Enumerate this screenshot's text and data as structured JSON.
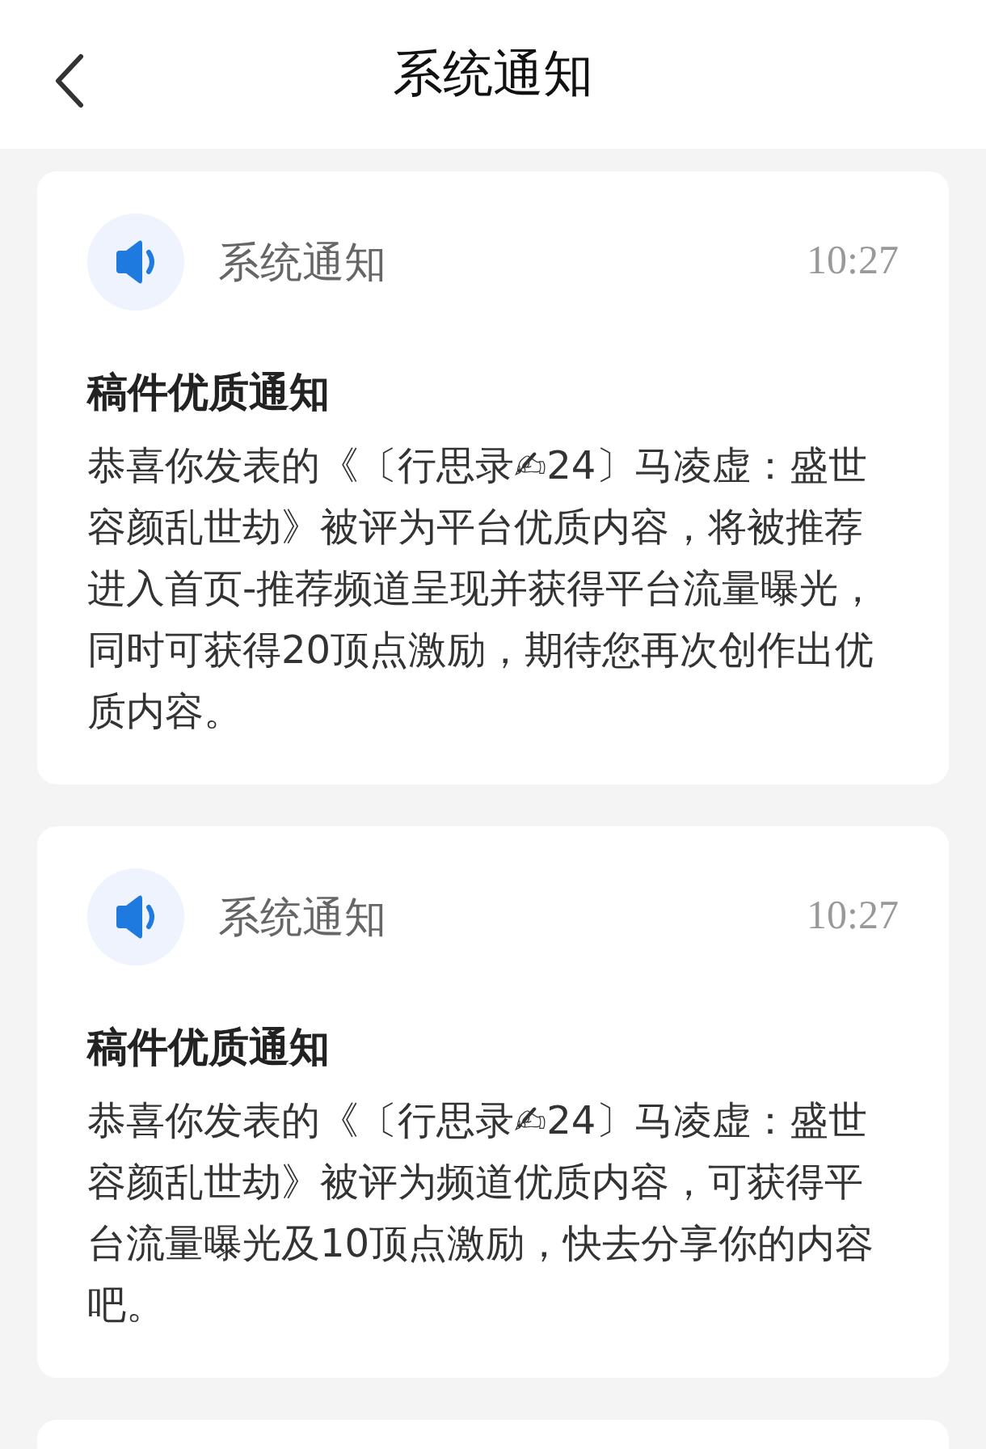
{
  "header": {
    "title": "系统通知"
  },
  "notifications": [
    {
      "source": "系统通知",
      "time": "10:27",
      "title": "稿件优质通知",
      "body": "恭喜你发表的《〔行思录✍24〕马凌虚：盛世容颜乱世劫》被评为平台优质内容，将被推荐进入首页-推荐频道呈现并获得平台流量曝光，同时可获得20顶点激励，期待您再次创作出优质内容。"
    },
    {
      "source": "系统通知",
      "time": "10:27",
      "title": "稿件优质通知",
      "body": "恭喜你发表的《〔行思录✍24〕马凌虚：盛世容颜乱世劫》被评为频道优质内容，可获得平台流量曝光及10顶点激励，快去分享你的内容吧。"
    }
  ]
}
